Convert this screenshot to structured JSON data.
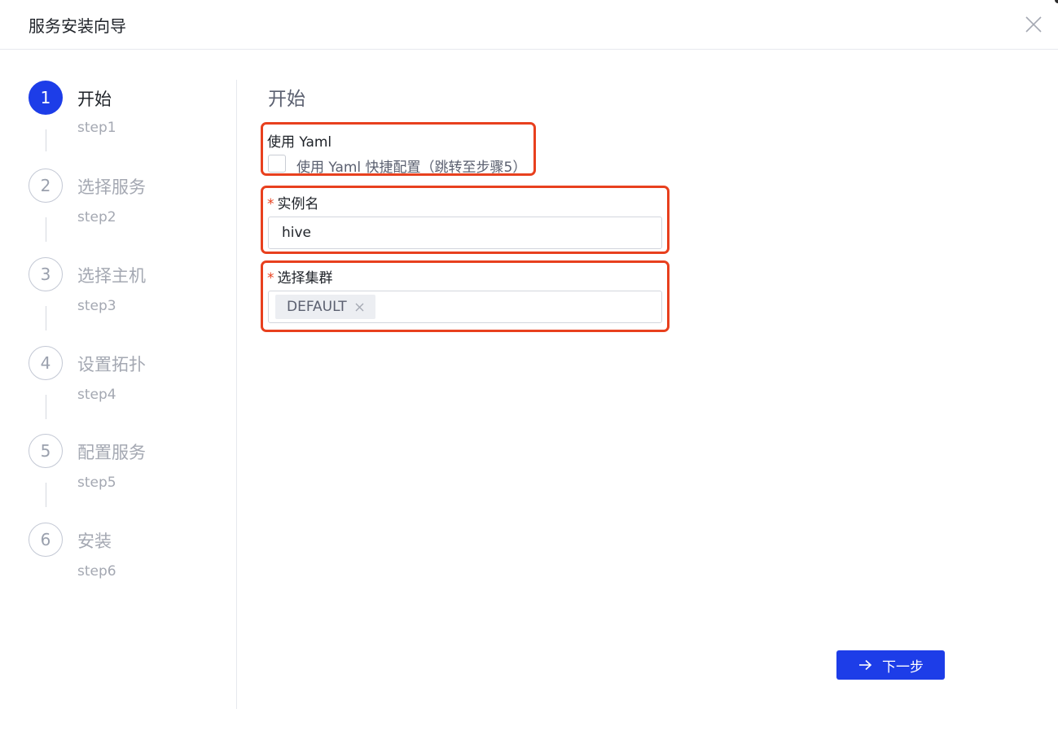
{
  "header": {
    "title": "服务安装向导",
    "close_icon": "close-icon"
  },
  "steps": [
    {
      "number": "1",
      "title": "开始",
      "sub": "step1",
      "state": "active"
    },
    {
      "number": "2",
      "title": "选择服务",
      "sub": "step2",
      "state": "pending"
    },
    {
      "number": "3",
      "title": "选择主机",
      "sub": "step3",
      "state": "pending"
    },
    {
      "number": "4",
      "title": "设置拓扑",
      "sub": "step4",
      "state": "pending"
    },
    {
      "number": "5",
      "title": "配置服务",
      "sub": "step5",
      "state": "pending"
    },
    {
      "number": "6",
      "title": "安装",
      "sub": "step6",
      "state": "pending"
    }
  ],
  "main": {
    "section_title": "开始",
    "yaml": {
      "label": "使用 Yaml",
      "checkbox_label": "使用 Yaml 快捷配置（跳转至步骤5）",
      "checked": false
    },
    "instance": {
      "required_mark": "*",
      "label": "实例名",
      "value": "hive"
    },
    "cluster": {
      "required_mark": "*",
      "label": "选择集群",
      "tags": [
        "DEFAULT"
      ]
    },
    "next_button": {
      "label": "下一步",
      "icon": "arrow-right-icon"
    }
  },
  "colors": {
    "primary": "#1d3de8",
    "highlight_border": "#e8401e",
    "required": "#e8401e"
  }
}
